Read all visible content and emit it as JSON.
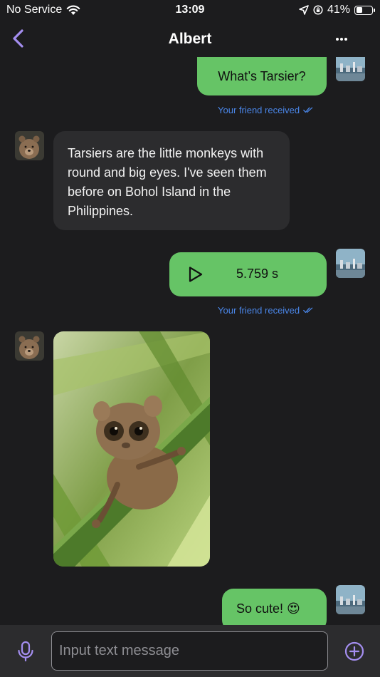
{
  "status_bar": {
    "carrier": "No Service",
    "time": "13:09",
    "battery": "41%",
    "battery_level": 0.41,
    "icons": [
      "wifi-icon",
      "location-arrow-icon",
      "orientation-lock-icon",
      "battery-icon"
    ]
  },
  "nav": {
    "title": "Albert",
    "back_icon": "chevron-left-icon",
    "more_icon": "ellipsis-icon"
  },
  "messages": {
    "m1": {
      "text": "What’s Tarsier?",
      "receipt": "Your friend received"
    },
    "m2": {
      "text": "Tarsiers are the little monkeys with round and big eyes. I've seen them before on Bohol Island in the Philippines."
    },
    "m3": {
      "duration": "5.759 s",
      "receipt": "Your friend received"
    },
    "m4": {
      "type": "image",
      "subject": "tarsier"
    },
    "m5": {
      "text": "So cute! 😍"
    }
  },
  "input": {
    "placeholder": "Input text message",
    "value": ""
  },
  "colors": {
    "sent_bubble": "#66c466",
    "received_bubble": "#2c2c2e",
    "accent": "#a48ef0",
    "receipt": "#4a86e8",
    "background": "#1c1c1e"
  }
}
